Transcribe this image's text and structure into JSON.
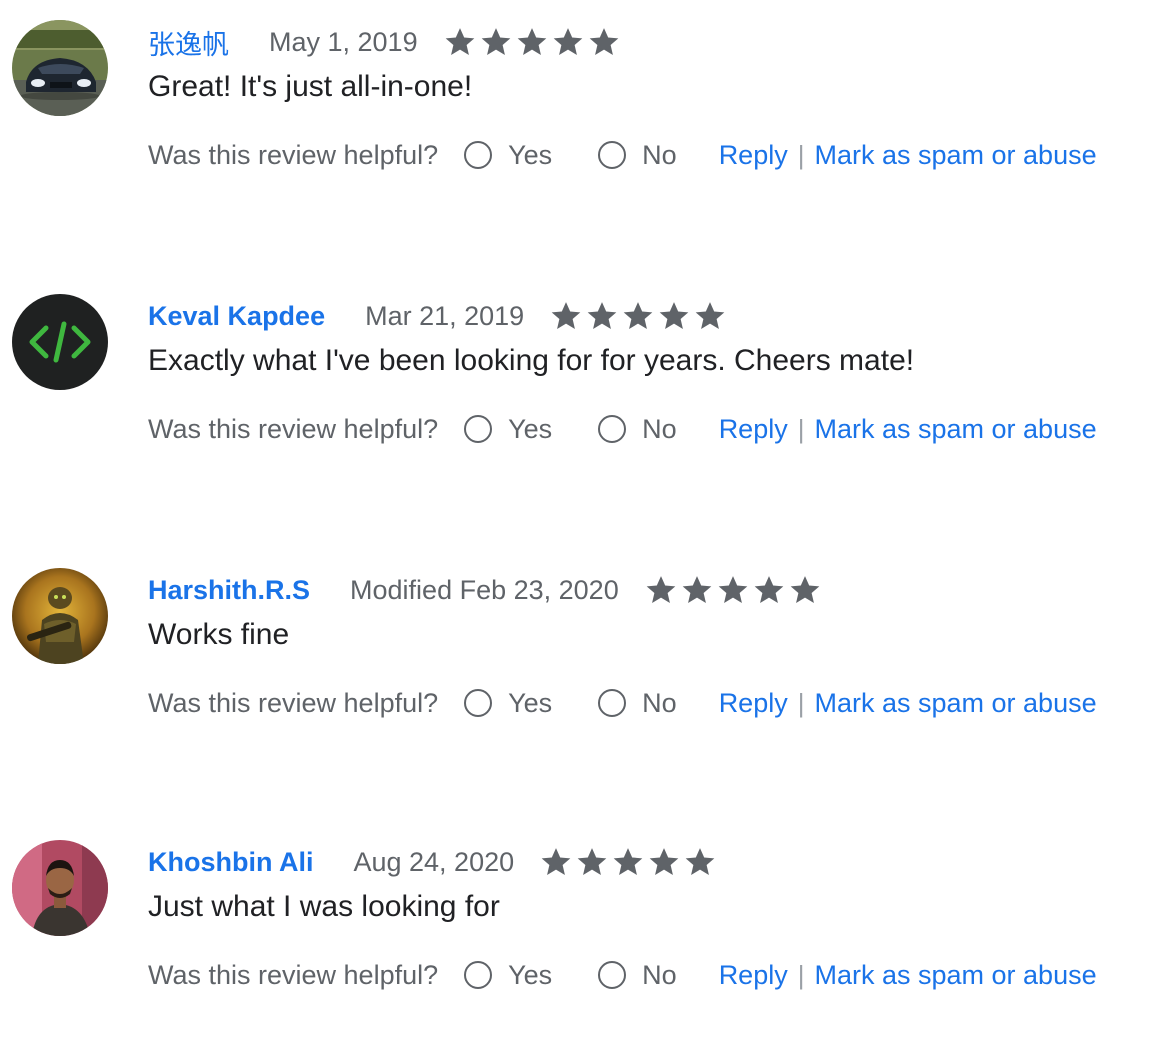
{
  "colors": {
    "link": "#1a73e8",
    "meta_text": "#5f6368",
    "body_text": "#202124",
    "star": "#5f6368"
  },
  "helpful_question": "Was this review helpful?",
  "yes_label": "Yes",
  "no_label": "No",
  "reply_label": "Reply",
  "separator": "|",
  "spam_label": "Mark as spam or abuse",
  "reviews": [
    {
      "author": "张逸帆",
      "date": "May 1, 2019",
      "rating": 5,
      "text": "Great! It's just all-in-one!",
      "avatar_icon": "sports-car-photo-icon"
    },
    {
      "author": "Keval Kapdee",
      "date": "Mar 21, 2019",
      "rating": 5,
      "text": "Exactly what I've been looking for for years. Cheers mate!",
      "avatar_icon": "code-brackets-icon"
    },
    {
      "author": "Harshith.R.S",
      "date": "Modified Feb 23, 2020",
      "rating": 5,
      "text": "Works fine",
      "avatar_icon": "armored-soldier-photo-icon"
    },
    {
      "author": "Khoshbin Ali",
      "date": "Aug 24, 2020",
      "rating": 5,
      "text": "Just what I was looking for",
      "avatar_icon": "person-photo-icon"
    }
  ]
}
